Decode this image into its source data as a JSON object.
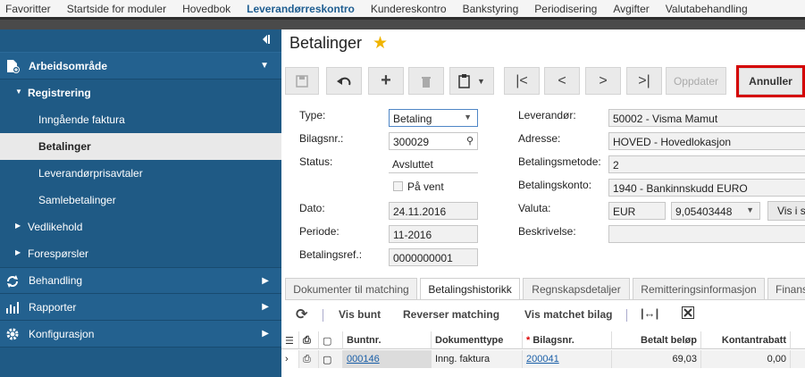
{
  "topnav": {
    "items": [
      {
        "label": "Favoritter"
      },
      {
        "label": "Startside for moduler"
      },
      {
        "label": "Hovedbok"
      },
      {
        "label": "Leverandørreskontro",
        "active": true
      },
      {
        "label": "Kundereskontro"
      },
      {
        "label": "Bankstyring"
      },
      {
        "label": "Periodisering"
      },
      {
        "label": "Avgifter"
      },
      {
        "label": "Valutabehandling"
      }
    ]
  },
  "sidebar": {
    "collapse_icon": "collapse-left-icon",
    "workspace": {
      "label": "Arbeidsområde"
    },
    "registrering": {
      "label": "Registrering"
    },
    "leaves": [
      {
        "label": "Inngående faktura"
      },
      {
        "label": "Betalinger",
        "active": true
      },
      {
        "label": "Leverandørprisavtaler"
      },
      {
        "label": "Samlebetalinger"
      }
    ],
    "vedlikehold": {
      "label": "Vedlikehold"
    },
    "foresporsler": {
      "label": "Forespørsler"
    },
    "behandling": {
      "label": "Behandling"
    },
    "rapporter": {
      "label": "Rapporter"
    },
    "konfigurasjon": {
      "label": "Konfigurasjon"
    }
  },
  "page": {
    "title": "Betalinger"
  },
  "toolbar": {
    "oppdater": "Oppdater",
    "annuller": "Annuller"
  },
  "form": {
    "type_label": "Type:",
    "type_value": "Betaling",
    "bilagsnr_label": "Bilagsnr.:",
    "bilagsnr_value": "300029",
    "status_label": "Status:",
    "status_value": "Avsluttet",
    "pavent_label": "På vent",
    "dato_label": "Dato:",
    "dato_value": "24.11.2016",
    "periode_label": "Periode:",
    "periode_value": "11-2016",
    "betref_label": "Betalingsref.:",
    "betref_value": "0000000001",
    "leverandor_label": "Leverandør:",
    "leverandor_value": "50002 - Visma Mamut",
    "adresse_label": "Adresse:",
    "adresse_value": "HOVED - Hovedlokasjon",
    "betmetode_label": "Betalingsmetode:",
    "betmetode_value": "2",
    "betkonto_label": "Betalingskonto:",
    "betkonto_value": "1940 - Bankinnskudd EURO",
    "valuta_label": "Valuta:",
    "valuta_value": "EUR",
    "kurs_value": "9,05403448",
    "vis_label": "Vis i s",
    "beskrivelse_label": "Beskrivelse:"
  },
  "tabs": [
    {
      "label": "Dokumenter til matching"
    },
    {
      "label": "Betalingshistorikk",
      "active": true
    },
    {
      "label": "Regnskapsdetaljer"
    },
    {
      "label": "Remitteringsinformasjon"
    },
    {
      "label": "Finans"
    }
  ],
  "grid_toolbar": {
    "vis_bunt": "Vis bunt",
    "reverser": "Reverser matching",
    "vis_matchet": "Vis matchet bilag"
  },
  "grid": {
    "headers": {
      "buntnr": "Buntnr.",
      "dokumenttype": "Dokumenttype",
      "bilagsnr": "Bilagsnr.",
      "betalt": "Betalt beløp",
      "kontantrabatt": "Kontantrabatt"
    },
    "rows": [
      {
        "buntnr": "000146",
        "dokumenttype": "Inng. faktura",
        "bilagsnr": "200041",
        "betalt": "69,03",
        "kontantrabatt": "0,00"
      }
    ]
  },
  "colors": {
    "sidebar": "#1f5a85",
    "accent": "#1f5e91",
    "highlight": "#d40000",
    "star": "#f0b400"
  }
}
